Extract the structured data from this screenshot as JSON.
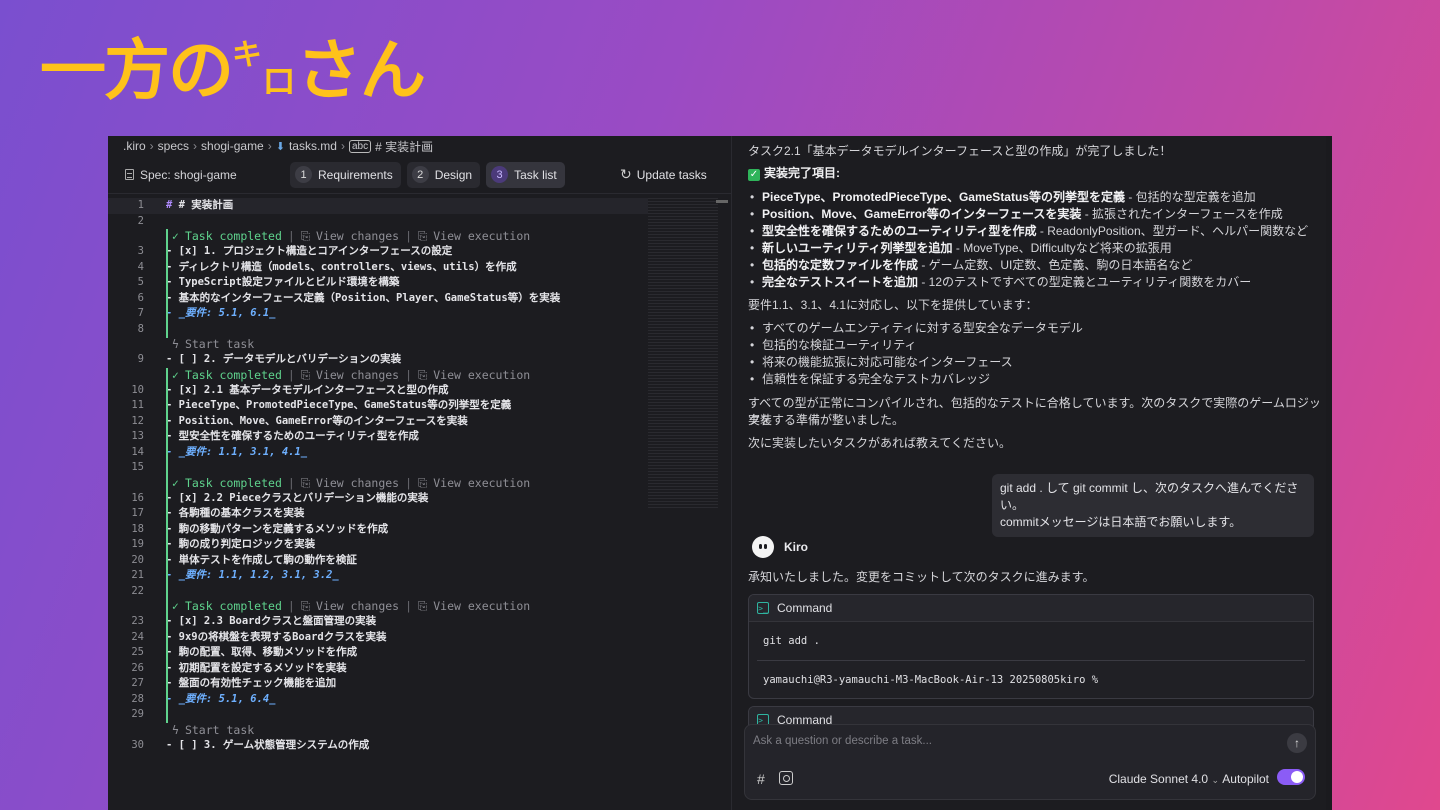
{
  "brand": {
    "main1": "一方の",
    "small": "キ",
    "small2": "ロ",
    "main2": "さん"
  },
  "breadcrumb": [
    ".kiro",
    "specs",
    "shogi-game",
    "tasks.md",
    "# 実装計画"
  ],
  "spec_bar": {
    "title": "Spec: shogi-game",
    "tabs": [
      {
        "num": "1",
        "label": "Requirements"
      },
      {
        "num": "2",
        "label": "Design"
      },
      {
        "num": "3",
        "label": "Task list"
      }
    ],
    "update": "Update tasks"
  },
  "lens": {
    "completed": "Task completed",
    "view_changes": "View changes",
    "view_execution": "View execution",
    "start": "Start task"
  },
  "code": {
    "l1": "# 実装計画",
    "l3": "- [x] 1. プロジェクト構造とコアインターフェースの設定",
    "l4": "  - ディレクトリ構造（models、controllers、views、utils）を作成",
    "l5": "  - TypeScript設定ファイルとビルド環境を構築",
    "l6": "  - 基本的なインターフェース定義（Position、Player、GameStatus等）を実装",
    "l7": "  - _要件: 5.1, 6.1_",
    "l9": "- [ ] 2. データモデルとバリデーションの実装",
    "l10": "  - [x] 2.1 基本データモデルインターフェースと型の作成",
    "l11": "    - PieceType、PromotedPieceType、GameStatus等の列挙型を定義",
    "l12": "    - Position、Move、GameError等のインターフェースを実装",
    "l13": "    - 型安全性を確保するためのユーティリティ型を作成",
    "l14": "    - _要件: 1.1, 3.1, 4.1_",
    "l16": "  - [x] 2.2 Pieceクラスとバリデーション機能の実装",
    "l17": "    - 各駒種の基本クラスを実装",
    "l18": "    - 駒の移動パターンを定義するメソッドを作成",
    "l19": "    - 駒の成り判定ロジックを実装",
    "l20": "    - 単体テストを作成して駒の動作を検証",
    "l21": "    - _要件: 1.1, 1.2, 3.1, 3.2_",
    "l23": "  - [x] 2.3 Boardクラスと盤面管理の実装",
    "l24": "    - 9x9の将棋盤を表現するBoardクラスを実装",
    "l25": "    - 駒の配置、取得、移動メソッドを作成",
    "l26": "    - 初期配置を設定するメソッドを実装",
    "l27": "    - 盤面の有効性チェック機能を追加",
    "l28": "    - _要件: 5.1, 6.4_",
    "l30": "- [ ] 3. ゲーム状態管理システムの作成"
  },
  "chat": {
    "msg1": "タスク2.1「基本データモデルインターフェースと型の作成」が完了しました！",
    "done_heading": "実装完了項目:",
    "done_items": [
      {
        "bold": "PieceType、PromotedPieceType、GameStatus等の列挙型を定義",
        "rest": " - 包括的な型定義を追加"
      },
      {
        "bold": "Position、Move、GameError等のインターフェースを実装",
        "rest": " - 拡張されたインターフェースを作成"
      },
      {
        "bold": "型安全性を確保するためのユーティリティ型を作成",
        "rest": " - ReadonlyPosition、型ガード、ヘルパー関数など"
      },
      {
        "bold": "新しいユーティリティ列挙型を追加",
        "rest": " - MoveType、Difficultyなど将来の拡張用"
      },
      {
        "bold": "包括的な定数ファイルを作成",
        "rest": " - ゲーム定数、UI定数、色定義、駒の日本語名など"
      },
      {
        "bold": "完全なテストスイートを追加",
        "rest": " - 12のテストですべての型定義とユーティリティ関数をカバー"
      }
    ],
    "req_intro": "要件1.1、3.1、4.1に対応し、以下を提供しています：",
    "provides": [
      "すべてのゲームエンティティに対する型安全なデータモデル",
      "包括的な検証ユーティリティ",
      "将来の機能拡張に対応可能なインターフェース",
      "信頼性を保証する完全なテストカバレッジ"
    ],
    "summary1": "すべての型が正常にコンパイルされ、包括的なテストに合格しています。次のタスクで実際のゲームロジックを",
    "summary2": "実装する準備が整いました。",
    "next": "次に実装したいタスクがあれば教えてください。",
    "user1": "git add . して git commit し、次のタスクへ進んでください。",
    "user2": "commitメッセージは日本語でお願いします。",
    "agent_name": "Kiro",
    "reply": "承知いたしました。変更をコミットして次のタスクに進みます。",
    "command_label": "Command",
    "cmd1": "git add .",
    "cmd_prompt": "yamauchi@R3-yamauchi-M3-MacBook-Air-13 20250805kiro %",
    "command_label2": "Command",
    "input_placeholder": "Ask a question or describe a task...",
    "model": "Claude Sonnet 4.0",
    "autopilot": "Autopilot"
  }
}
